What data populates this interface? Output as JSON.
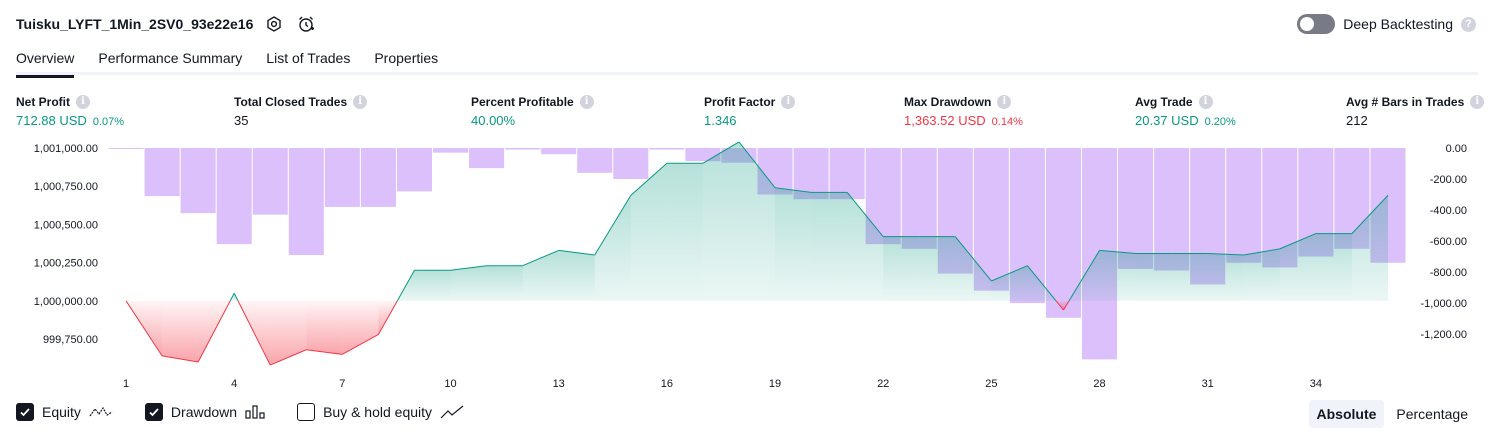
{
  "header": {
    "strategy_name": "Tuisku_LYFT_1Min_2SV0_93e22e16",
    "deep_backtesting_label": "Deep Backtesting",
    "deep_backtesting_enabled": false,
    "help_glyph": "?"
  },
  "tabs": [
    {
      "label": "Overview",
      "active": true
    },
    {
      "label": "Performance Summary",
      "active": false
    },
    {
      "label": "List of Trades",
      "active": false
    },
    {
      "label": "Properties",
      "active": false
    }
  ],
  "stats": [
    {
      "label": "Net Profit",
      "value": "712.88 USD",
      "pct": "0.07%",
      "color": "#089981"
    },
    {
      "label": "Total Closed Trades",
      "value": "35",
      "pct": "",
      "color": "#131722"
    },
    {
      "label": "Percent Profitable",
      "value": "40.00%",
      "pct": "",
      "color": "#089981"
    },
    {
      "label": "Profit Factor",
      "value": "1.346",
      "pct": "",
      "color": "#089981"
    },
    {
      "label": "Max Drawdown",
      "value": "1,363.52 USD",
      "pct": "0.14%",
      "color": "#f23645"
    },
    {
      "label": "Avg Trade",
      "value": "20.37 USD",
      "pct": "0.20%",
      "color": "#089981"
    },
    {
      "label": "Avg # Bars in Trades",
      "value": "212",
      "pct": "",
      "color": "#131722"
    }
  ],
  "info_glyph": "i",
  "chart_data": {
    "type": "line",
    "x": [
      1,
      2,
      3,
      4,
      5,
      6,
      7,
      8,
      9,
      10,
      11,
      12,
      13,
      14,
      15,
      16,
      17,
      18,
      19,
      20,
      21,
      22,
      23,
      24,
      25,
      26,
      27,
      28,
      29,
      30,
      31,
      32,
      33,
      34,
      35,
      36
    ],
    "x_ticks": [
      "1",
      "4",
      "7",
      "10",
      "13",
      "16",
      "19",
      "22",
      "25",
      "28",
      "31",
      "34"
    ],
    "left_axis": {
      "ticks": [
        "1,001,000.00",
        "1,000,750.00",
        "1,000,500.00",
        "1,000,250.00",
        "1,000,000.00",
        "999,750.00"
      ],
      "range": [
        999600,
        1001000
      ],
      "baseline": 1000000
    },
    "right_axis": {
      "ticks": [
        "0.00",
        "-200.00",
        "-400.00",
        "-600.00",
        "-800.00",
        "-1,000.00",
        "-1,200.00"
      ],
      "range": [
        -1380,
        0
      ]
    },
    "series": [
      {
        "name": "Equity",
        "color_up": "#089981",
        "color_down": "#f23645",
        "values": [
          1000000,
          999640,
          999600,
          1000050,
          999580,
          999680,
          999650,
          999780,
          1000200,
          1000200,
          1000230,
          1000230,
          1000330,
          1000300,
          1000690,
          1000900,
          1000900,
          1001040,
          1000740,
          1000710,
          1000710,
          1000420,
          1000420,
          1000420,
          1000130,
          1000230,
          999940,
          1000330,
          1000310,
          1000310,
          1000310,
          1000300,
          1000340,
          1000440,
          1000440,
          1000690
        ]
      },
      {
        "name": "Drawdown",
        "color": "#cfa8fa",
        "values": [
          -6,
          -310,
          -420,
          -620,
          -430,
          -690,
          -380,
          -380,
          -280,
          -30,
          -130,
          -10,
          -40,
          -160,
          -200,
          -10,
          -85,
          -95,
          -300,
          -330,
          -330,
          -620,
          -650,
          -810,
          -920,
          -1000,
          -1095,
          -1363,
          -780,
          -790,
          -880,
          -740,
          -770,
          -700,
          -650,
          -740
        ]
      }
    ]
  },
  "legend": {
    "items": [
      {
        "label": "Equity",
        "checked": true,
        "icon": "equity-line-icon"
      },
      {
        "label": "Drawdown",
        "checked": true,
        "icon": "drawdown-bars-icon"
      },
      {
        "label": "Buy & hold equity",
        "checked": false,
        "icon": "buy-hold-line-icon"
      }
    ]
  },
  "mode": {
    "absolute_label": "Absolute",
    "percentage_label": "Percentage",
    "selected": "Absolute"
  }
}
